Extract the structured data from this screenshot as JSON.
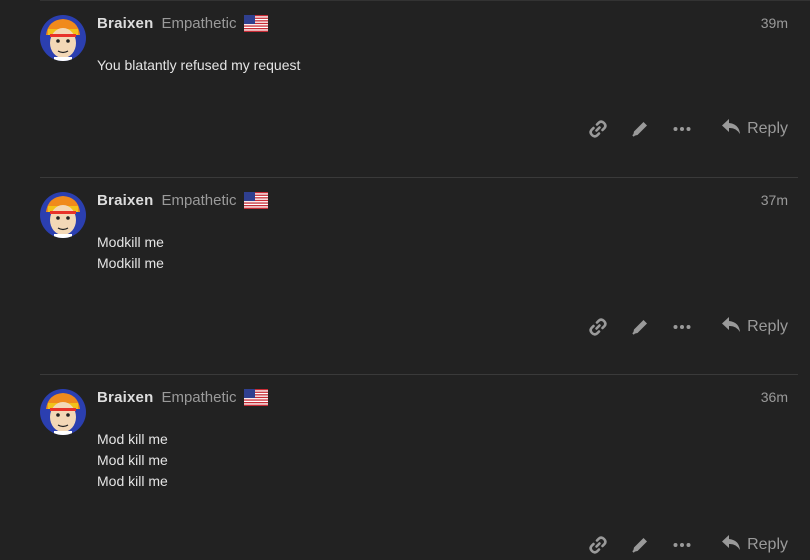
{
  "posts": [
    {
      "username": "Braixen",
      "user_title": "Empathetic",
      "flag_icon": "us-flag-icon",
      "time": "39m",
      "lines": [
        "You blatantly refused my request"
      ],
      "actions": {
        "icons": [
          "link-icon",
          "pencil-icon",
          "more-icon",
          "reply-icon"
        ],
        "reply_label": "Reply"
      }
    },
    {
      "username": "Braixen",
      "user_title": "Empathetic",
      "flag_icon": "us-flag-icon",
      "time": "37m",
      "lines": [
        "Modkill me",
        "Modkill me"
      ],
      "actions": {
        "icons": [
          "link-icon",
          "pencil-icon",
          "more-icon",
          "reply-icon"
        ],
        "reply_label": "Reply"
      }
    },
    {
      "username": "Braixen",
      "user_title": "Empathetic",
      "flag_icon": "us-flag-icon",
      "time": "36m",
      "lines": [
        "Mod kill me",
        "Mod kill me",
        "Mod kill me"
      ],
      "actions": {
        "icons": [
          "link-icon",
          "pencil-icon",
          "more-icon",
          "reply-icon"
        ],
        "reply_label": "Reply"
      }
    }
  ],
  "colors": {
    "background": "#222222",
    "text": "#dddddd",
    "muted": "#9a9a9a",
    "divider": "#3a3a3a"
  }
}
